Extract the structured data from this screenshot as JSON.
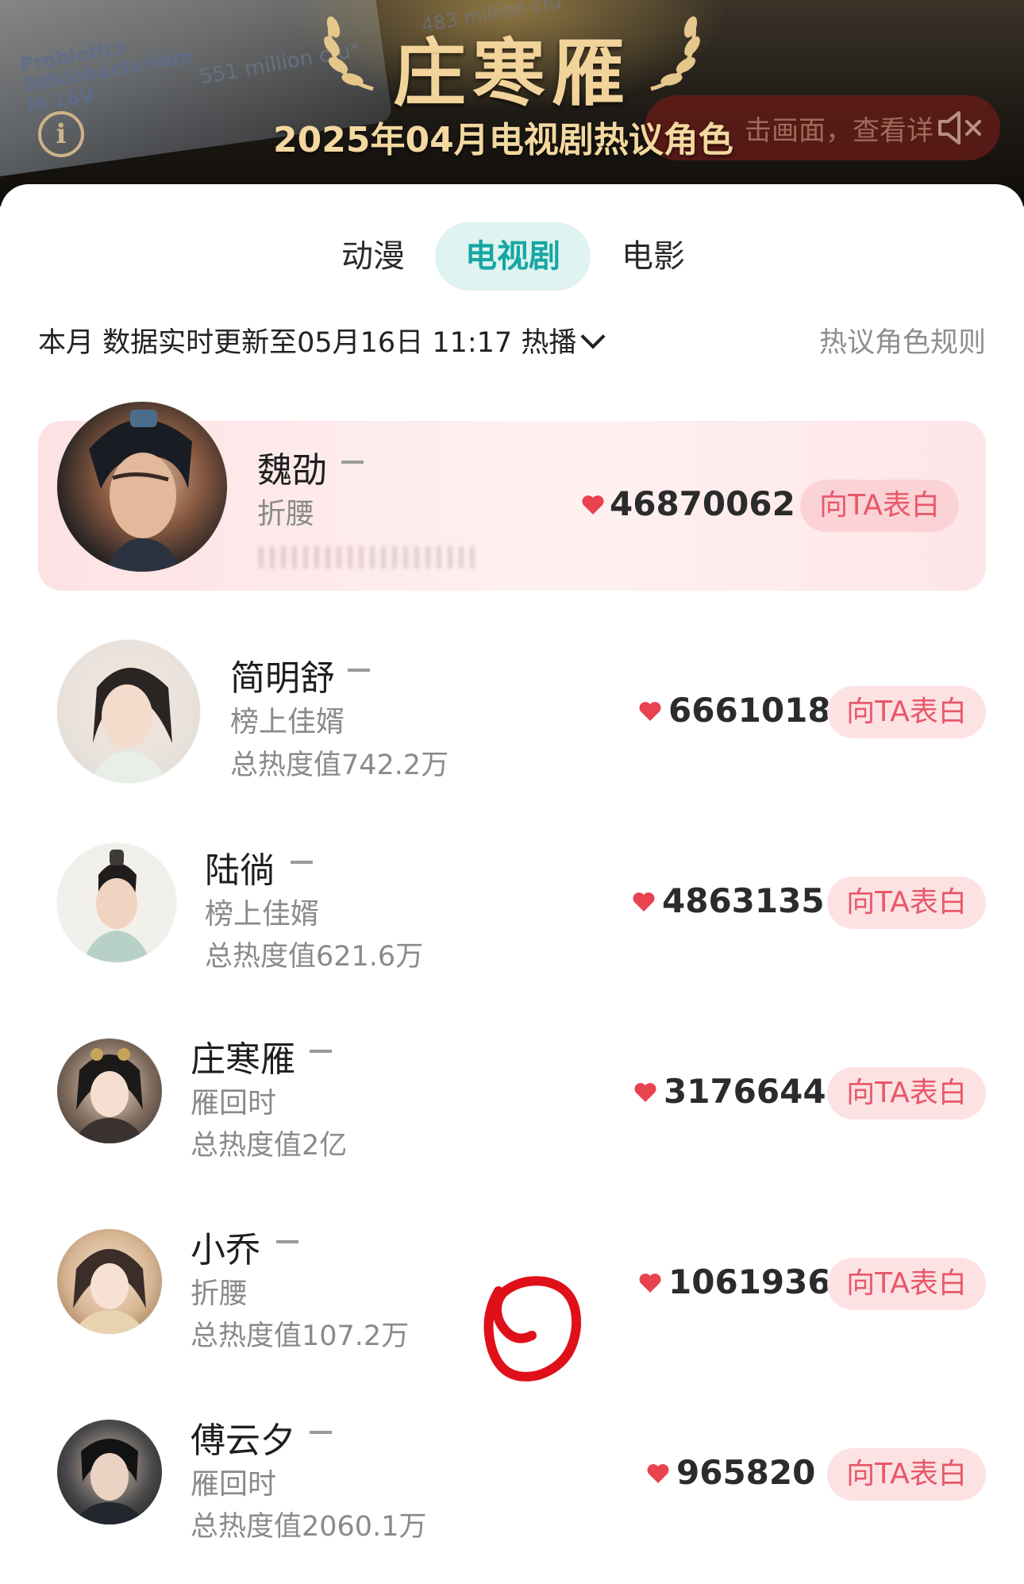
{
  "banner": {
    "name": "庄寒雁",
    "subtitle": "2025年04月电视剧热议角色",
    "deco_text_1": "Probiotics\nBifidobacterium\nM-16V",
    "deco_text_2": "551 million cfu*",
    "deco_text_3": "483 million cfu",
    "mute_hint": "击画面，查看详",
    "info_icon": "info-icon",
    "mute_icon": "speaker-muted-icon",
    "accent_color": "#f2d39a"
  },
  "tabs": [
    {
      "label": "动漫",
      "active": false
    },
    {
      "label": "电视剧",
      "active": true
    },
    {
      "label": "电影",
      "active": false
    }
  ],
  "filter": {
    "text": "本月 数据实时更新至05月16日 11:17 热播",
    "rules_link": "热议角色规则"
  },
  "list": [
    {
      "name": "魏劭",
      "trend": "–",
      "show": "折腰",
      "total": "",
      "score": "46870062",
      "button": "向TA表白",
      "highlight": true
    },
    {
      "name": "简明舒",
      "trend": "–",
      "show": "榜上佳婿",
      "total": "总热度值742.2万",
      "score": "6661018",
      "button": "向TA表白",
      "highlight": false
    },
    {
      "name": "陆徜",
      "trend": "–",
      "show": "榜上佳婿",
      "total": "总热度值621.6万",
      "score": "4863135",
      "button": "向TA表白",
      "highlight": false
    },
    {
      "name": "庄寒雁",
      "trend": "–",
      "show": "雁回时",
      "total": "总热度值2亿",
      "score": "3176644",
      "button": "向TA表白",
      "highlight": false
    },
    {
      "name": "小乔",
      "trend": "–",
      "show": "折腰",
      "total": "总热度值107.2万",
      "score": "1061936",
      "button": "向TA表白",
      "highlight": false
    },
    {
      "name": "傅云夕",
      "trend": "–",
      "show": "雁回时",
      "total": "总热度值2060.1万",
      "score": "965820",
      "button": "向TA表白",
      "highlight": false
    }
  ],
  "colors": {
    "heart": "#e8434f",
    "button_text": "#e8576a",
    "tab_active_bg": "#dff3f1",
    "tab_active_text": "#16a6a2",
    "doodle": "#e0101a"
  }
}
